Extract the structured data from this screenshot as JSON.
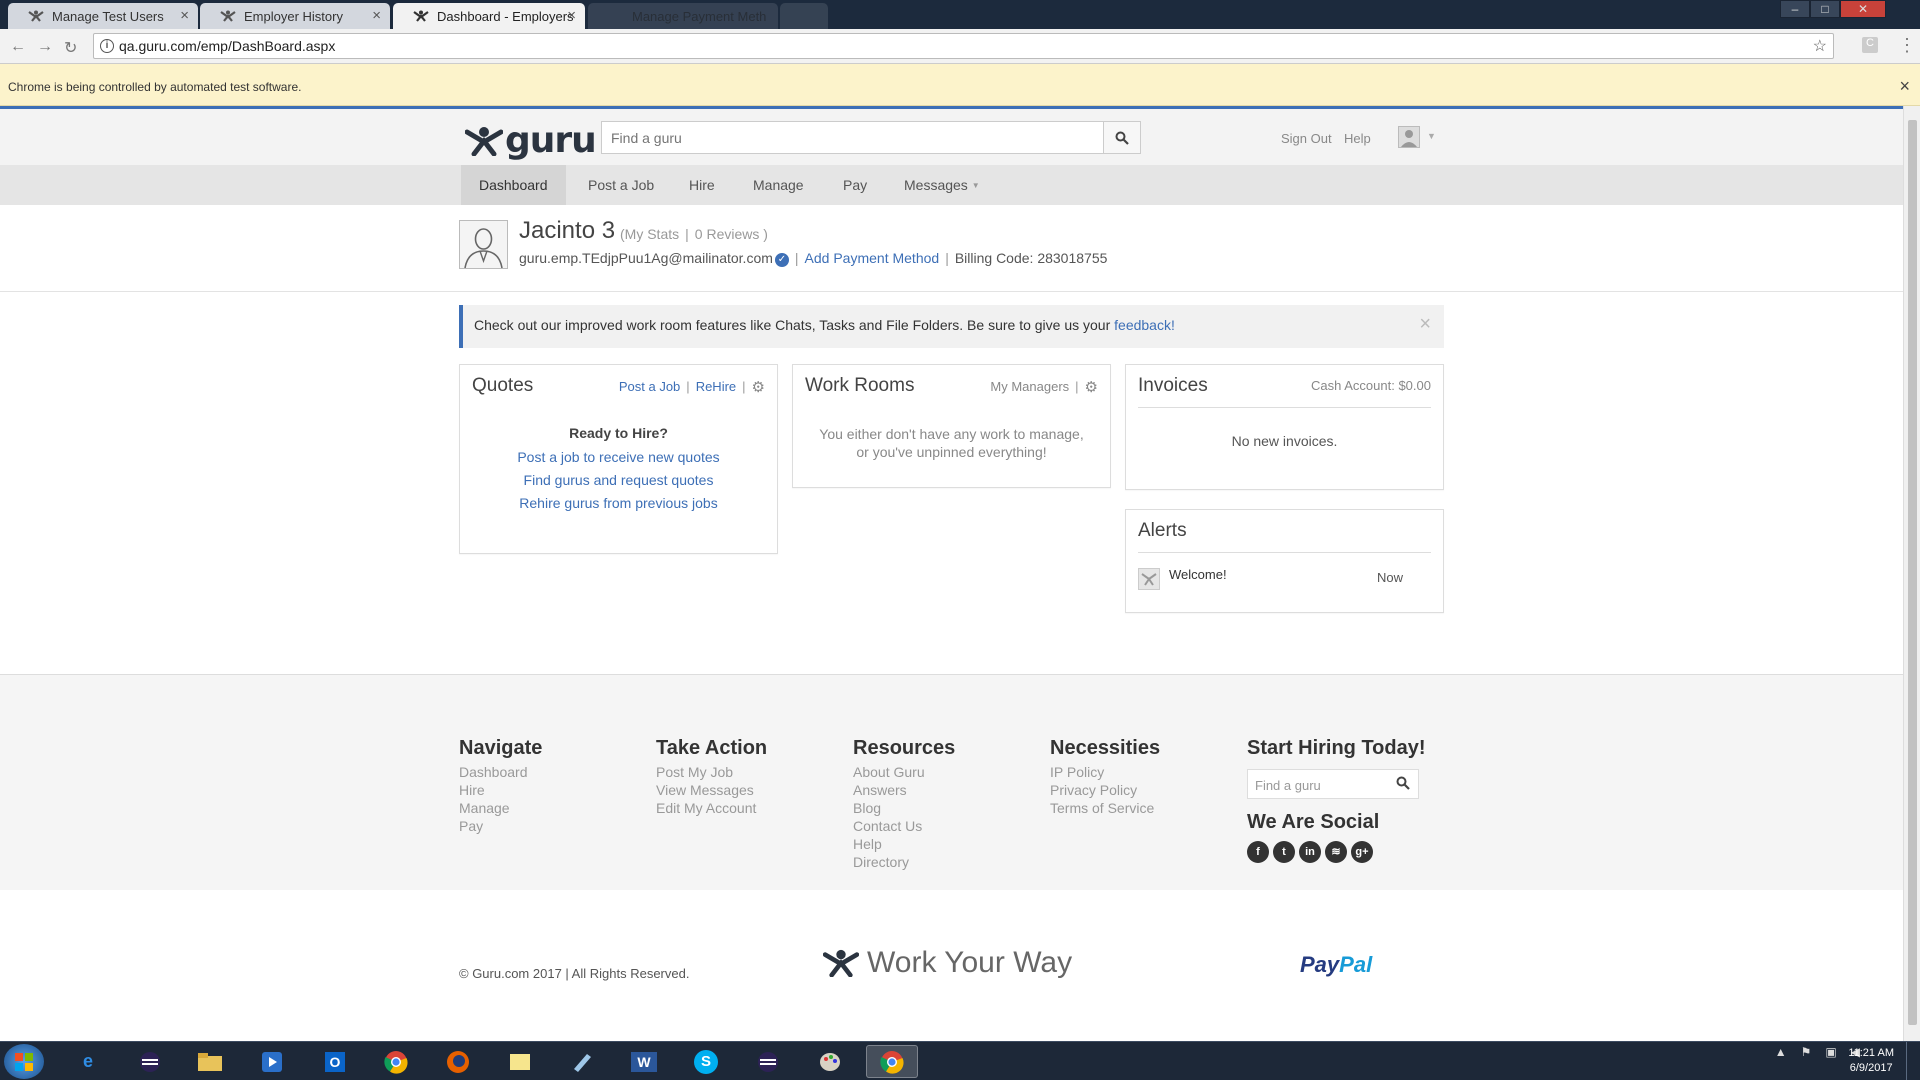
{
  "browser": {
    "tabs": [
      {
        "title": "Manage Test Users"
      },
      {
        "title": "Employer History"
      },
      {
        "title": "Dashboard - Employers"
      },
      {
        "title": "Manage Payment Meth"
      }
    ],
    "close_glyph": "×",
    "url": "qa.guru.com/emp/DashBoard.aspx",
    "infobar_text": "Chrome is being controlled by automated test software."
  },
  "header": {
    "logo_text": "guru",
    "search_placeholder": "Find a guru",
    "sign_out": "Sign Out",
    "help": "Help"
  },
  "nav": {
    "items": [
      {
        "label": "Dashboard"
      },
      {
        "label": "Post a Job"
      },
      {
        "label": "Hire"
      },
      {
        "label": "Manage"
      },
      {
        "label": "Pay"
      },
      {
        "label": "Messages"
      }
    ]
  },
  "profile": {
    "name": "Jacinto 3",
    "my_stats": "My Stats",
    "reviews": "0 Reviews",
    "email": "guru.emp.TEdjpPuu1Ag@mailinator.com",
    "add_payment": "Add Payment Method",
    "billing_code": "Billing Code: 283018755"
  },
  "notice": {
    "text": "Check out our improved work room features like Chats, Tasks and File Folders. Be sure to give us your ",
    "link": "feedback!"
  },
  "quotes": {
    "title": "Quotes",
    "post_job": "Post a Job",
    "rehire": "ReHire",
    "ready": "Ready to Hire?",
    "links": [
      "Post a job to receive new quotes",
      "Find gurus and request quotes",
      "Rehire gurus from previous jobs"
    ]
  },
  "workrooms": {
    "title": "Work Rooms",
    "my_managers": "My Managers",
    "message_line1": "You either don't have any work to manage,",
    "message_line2": "or you've unpinned everything!"
  },
  "invoices": {
    "title": "Invoices",
    "cash_account": "Cash Account: $0.00",
    "message": "No new invoices."
  },
  "alerts": {
    "title": "Alerts",
    "item_text": "Welcome!",
    "item_time": "Now"
  },
  "footer": {
    "navigate": {
      "title": "Navigate",
      "links": [
        "Dashboard",
        "Hire",
        "Manage",
        "Pay"
      ]
    },
    "take_action": {
      "title": "Take Action",
      "links": [
        "Post My Job",
        "View Messages",
        "Edit My Account"
      ]
    },
    "resources": {
      "title": "Resources",
      "links": [
        "About Guru",
        "Answers",
        "Blog",
        "Contact Us",
        "Help",
        "Directory"
      ]
    },
    "necessities": {
      "title": "Necessities",
      "links": [
        "IP Policy",
        "Privacy Policy",
        "Terms of Service"
      ]
    },
    "start_hiring": "Start Hiring Today!",
    "search_placeholder": "Find a guru",
    "social_title": "We Are Social"
  },
  "bottom": {
    "copyright": "© Guru.com 2017 | All Rights Reserved.",
    "tagline": "Work Your Way",
    "paypal_pay": "Pay",
    "paypal_pal": "Pal"
  },
  "taskbar": {
    "time": "11:21 AM",
    "date": "6/9/2017"
  },
  "colors": {
    "brand_blue": "#3d6fb6",
    "infobar_bg": "#fcf3cb",
    "taskbar_bg": "#1d2838"
  }
}
